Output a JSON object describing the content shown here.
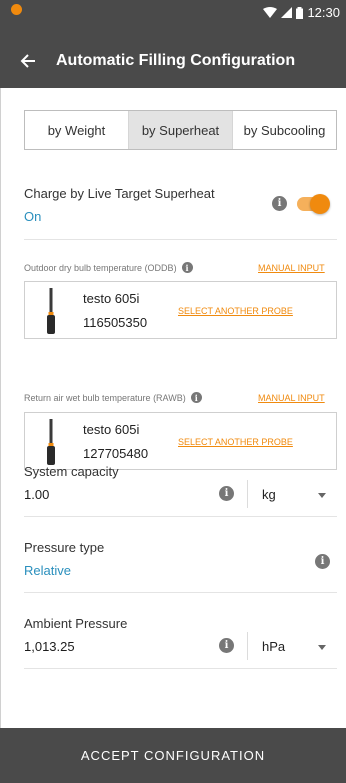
{
  "status_bar": {
    "time": "12:30"
  },
  "header": {
    "title": "Automatic Filling Configuration"
  },
  "tabs": [
    {
      "label": "by Weight"
    },
    {
      "label": "by Superheat",
      "active": true
    },
    {
      "label": "by Subcooling"
    }
  ],
  "live_target": {
    "label": "Charge by Live Target Superheat",
    "value": "On",
    "toggle_on": true
  },
  "oddb": {
    "label": "Outdoor dry bulb temperature (ODDB)",
    "manual_label": "MANUAL INPUT",
    "probe_name": "testo 605i",
    "probe_serial": "116505350",
    "select_label": "SELECT ANOTHER PROBE"
  },
  "rawb": {
    "label": "Return air wet bulb temperature (RAWB)",
    "manual_label": "MANUAL INPUT",
    "probe_name": "testo 605i",
    "probe_serial": "127705480",
    "select_label": "SELECT ANOTHER PROBE"
  },
  "system_capacity": {
    "label": "System capacity",
    "value": "1.00",
    "unit": "kg"
  },
  "pressure_type": {
    "label": "Pressure type",
    "value": "Relative"
  },
  "ambient_pressure": {
    "label": "Ambient Pressure",
    "value": "1,013.25",
    "unit": "hPa"
  },
  "footer": {
    "button_label": "ACCEPT CONFIGURATION"
  },
  "colors": {
    "accent": "#f08a0e",
    "link": "#2a8fbd",
    "bar": "#4a4a4a"
  }
}
